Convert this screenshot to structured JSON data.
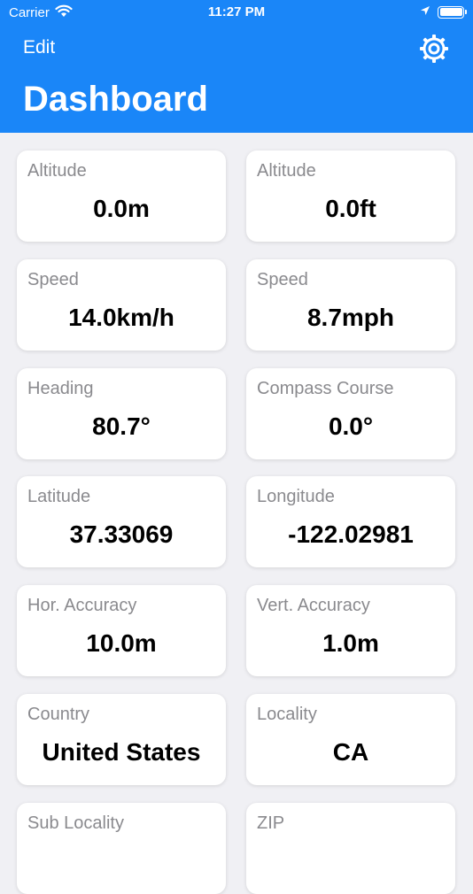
{
  "status_bar": {
    "carrier": "Carrier",
    "time": "11:27 PM"
  },
  "nav": {
    "edit_label": "Edit",
    "title": "Dashboard",
    "settings_icon": "gear-icon"
  },
  "colors": {
    "header_bg": "#1a86f8",
    "background": "#f0f0f4",
    "card_bg": "#ffffff",
    "label": "#8a8a8e"
  },
  "cards": [
    {
      "label": "Altitude",
      "value": "0.0m"
    },
    {
      "label": "Altitude",
      "value": "0.0ft"
    },
    {
      "label": "Speed",
      "value": "14.0km/h"
    },
    {
      "label": "Speed",
      "value": "8.7mph"
    },
    {
      "label": "Heading",
      "value": "80.7°"
    },
    {
      "label": "Compass Course",
      "value": "0.0°"
    },
    {
      "label": "Latitude",
      "value": "37.33069"
    },
    {
      "label": "Longitude",
      "value": "-122.02981"
    },
    {
      "label": "Hor. Accuracy",
      "value": "10.0m"
    },
    {
      "label": "Vert. Accuracy",
      "value": "1.0m"
    },
    {
      "label": "Country",
      "value": "United States"
    },
    {
      "label": "Locality",
      "value": "CA"
    },
    {
      "label": "Sub Locality",
      "value": ""
    },
    {
      "label": "ZIP",
      "value": ""
    }
  ]
}
